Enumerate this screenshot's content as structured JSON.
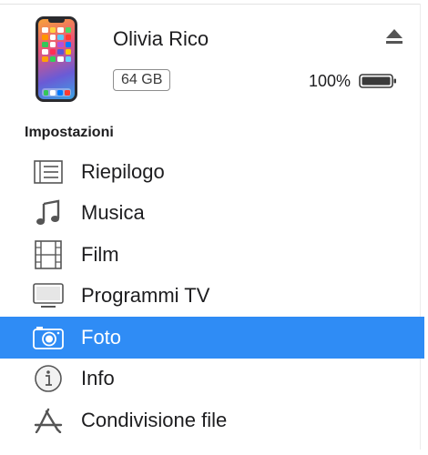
{
  "device": {
    "name": "Olivia Rico",
    "capacity": "64 GB",
    "battery": "100%"
  },
  "sidebar": {
    "section_title": "Impostazioni",
    "items": [
      {
        "label": "Riepilogo",
        "icon": "summary-list-icon"
      },
      {
        "label": "Musica",
        "icon": "music-note-icon"
      },
      {
        "label": "Film",
        "icon": "film-strip-icon"
      },
      {
        "label": "Programmi TV",
        "icon": "tv-monitor-icon"
      },
      {
        "label": "Foto",
        "icon": "camera-icon",
        "selected": true
      },
      {
        "label": "Info",
        "icon": "info-icon"
      },
      {
        "label": "Condivisione file",
        "icon": "app-store-icon"
      }
    ]
  },
  "colors": {
    "selection": "#2f8cf5",
    "text": "#1d1d1f",
    "icon": "#555555"
  }
}
